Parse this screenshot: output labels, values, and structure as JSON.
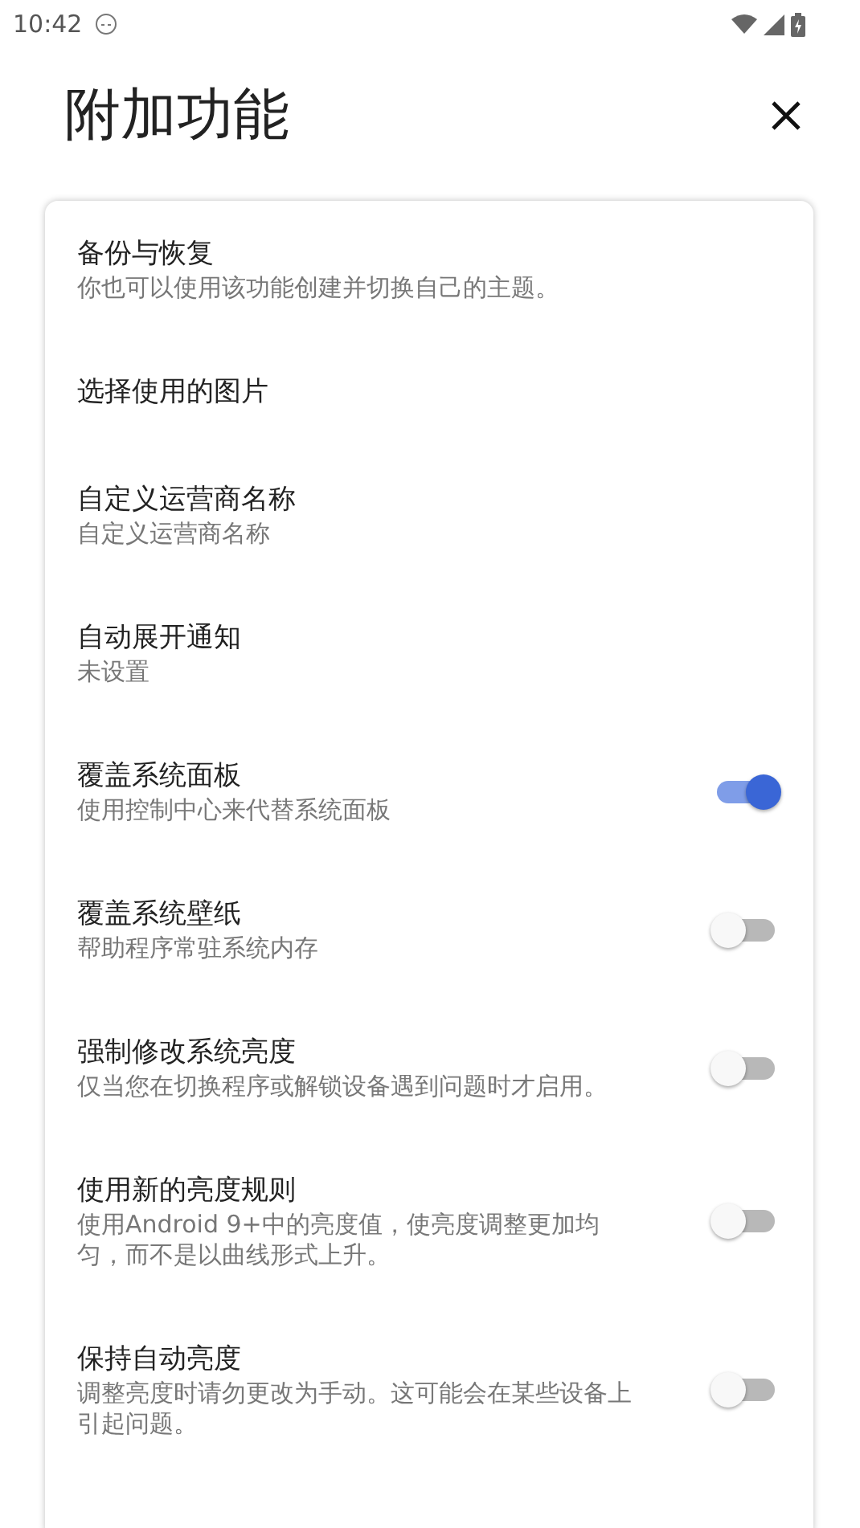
{
  "status_bar": {
    "time": "10:42"
  },
  "header": {
    "title": "附加功能"
  },
  "settings": [
    {
      "kind": "text",
      "title": "备份与恢复",
      "subtitle": "你也可以使用该功能创建并切换自己的主题。"
    },
    {
      "kind": "text",
      "title": "选择使用的图片"
    },
    {
      "kind": "text",
      "title": "自定义运营商名称",
      "subtitle": "自定义运营商名称"
    },
    {
      "kind": "text",
      "title": "自动展开通知",
      "subtitle": "未设置"
    },
    {
      "kind": "switch",
      "title": "覆盖系统面板",
      "subtitle": "使用控制中心来代替系统面板",
      "on": true
    },
    {
      "kind": "switch",
      "title": "覆盖系统壁纸",
      "subtitle": "帮助程序常驻系统内存",
      "on": false
    },
    {
      "kind": "switch",
      "title": "强制修改系统亮度",
      "subtitle": "仅当您在切换程序或解锁设备遇到问题时才启用。",
      "on": false
    },
    {
      "kind": "switch",
      "title": "使用新的亮度规则",
      "subtitle": "使用Android 9+中的亮度值，使亮度调整更加均匀，而不是以曲线形式上升。",
      "on": false
    },
    {
      "kind": "switch",
      "title": "保持自动亮度",
      "subtitle": "调整亮度时请勿更改为手动。这可能会在某些设备上引起问题。",
      "on": false
    }
  ]
}
